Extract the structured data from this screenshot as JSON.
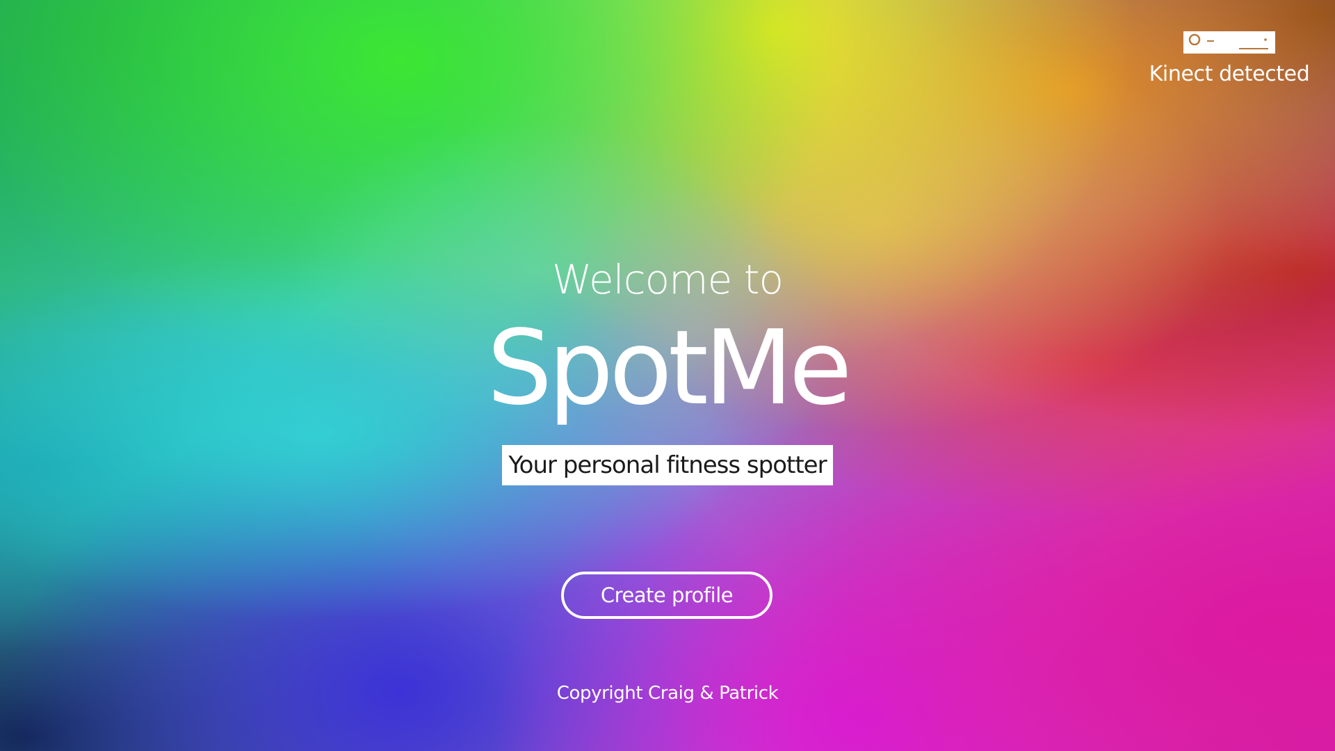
{
  "status": {
    "sensor_icon": "kinect-sensor-icon",
    "label": "Kinect detected"
  },
  "hero": {
    "welcome": "Welcome to",
    "app_name": "SpotMe",
    "tagline": "Your personal fitness spotter"
  },
  "actions": {
    "create_profile_label": "Create profile"
  },
  "footer": {
    "copyright": "Copyright Craig & Patrick"
  },
  "colors": {
    "text": "#ffffff",
    "tagline_bg": "#ffffff",
    "tagline_text": "#1a1a1a"
  }
}
